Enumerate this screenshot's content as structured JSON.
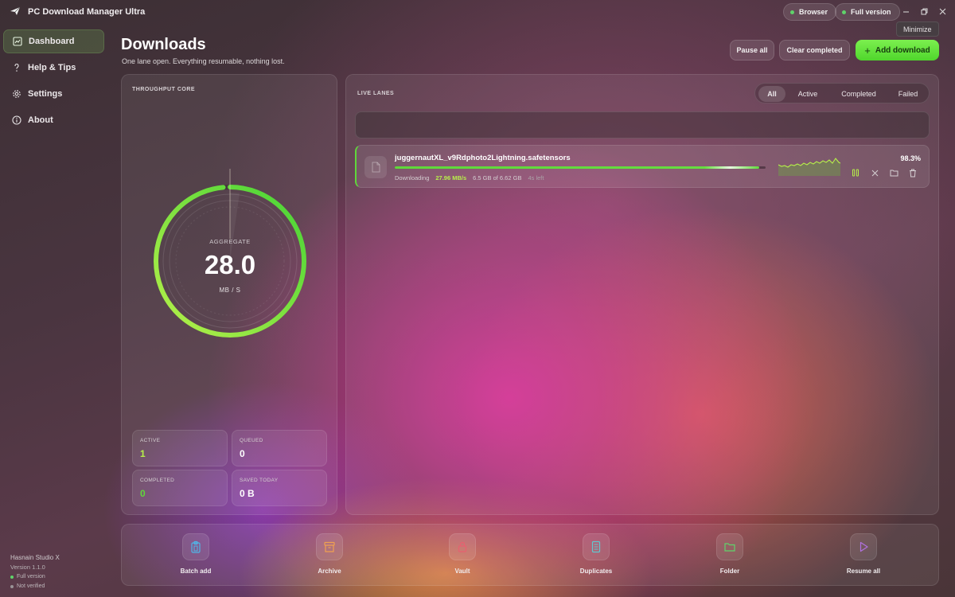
{
  "titlebar": {
    "app_title": "PC Download Manager Ultra",
    "browser_label": "Browser",
    "full_version_label": "Full version",
    "tooltip": "Minimize"
  },
  "sidebar": {
    "items": [
      {
        "label": "Dashboard",
        "icon": "dashboard-icon",
        "active": true
      },
      {
        "label": "Help & Tips",
        "icon": "question-icon",
        "active": false
      },
      {
        "label": "Settings",
        "icon": "gear-icon",
        "active": false
      },
      {
        "label": "About",
        "icon": "info-icon",
        "active": false
      }
    ],
    "footer": {
      "studio": "Hasnain Studio X",
      "version": "Version 1.1.0",
      "status1": "Full version",
      "status2": "Not verified"
    }
  },
  "header": {
    "title": "Downloads",
    "subtitle": "One lane open. Everything resumable, nothing lost.",
    "pause_all": "Pause all",
    "clear_completed": "Clear completed",
    "add_download": "Add download"
  },
  "throughput": {
    "label": "THROUGHPUT CORE",
    "gauge_label": "AGGREGATE",
    "value": "28.0",
    "unit": "MB / S",
    "gauge_fill": 0.985,
    "stats": [
      {
        "label": "ACTIVE",
        "value": "1",
        "color": "#b6f04a"
      },
      {
        "label": "QUEUED",
        "value": "0",
        "color": "#ffffff"
      },
      {
        "label": "COMPLETED",
        "value": "0",
        "color": "#5fd83a"
      },
      {
        "label": "SAVED TODAY",
        "value": "0 B",
        "color": "#ffffff"
      }
    ]
  },
  "lanes": {
    "label": "LIVE LANES",
    "filters": [
      "All",
      "Active",
      "Completed",
      "Failed"
    ],
    "active_filter": "All",
    "items": [
      {
        "filename": "juggernautXL_v9Rdphoto2Lightning.safetensors",
        "status": "Downloading",
        "speed": "27.96 MB/s",
        "size": "6.5 GB of 6.62 GB",
        "eta": "4s left",
        "percent": "98.3%",
        "progress": 0.983
      }
    ]
  },
  "actions": [
    {
      "label": "Batch add",
      "icon": "clipboard-icon",
      "color": "#4fb6e8"
    },
    {
      "label": "Archive",
      "icon": "archive-icon",
      "color": "#f0a050"
    },
    {
      "label": "Vault",
      "icon": "lock-icon",
      "color": "#e86070"
    },
    {
      "label": "Duplicates",
      "icon": "copy-icon",
      "color": "#60c8d0"
    },
    {
      "label": "Folder",
      "icon": "folder-icon",
      "color": "#5fd36a"
    },
    {
      "label": "Resume all",
      "icon": "play-icon",
      "color": "#b070e0"
    }
  ],
  "colors": {
    "accent": "#5fd83a",
    "accent_bright": "#7cf04f",
    "speed": "#b6f04a"
  }
}
